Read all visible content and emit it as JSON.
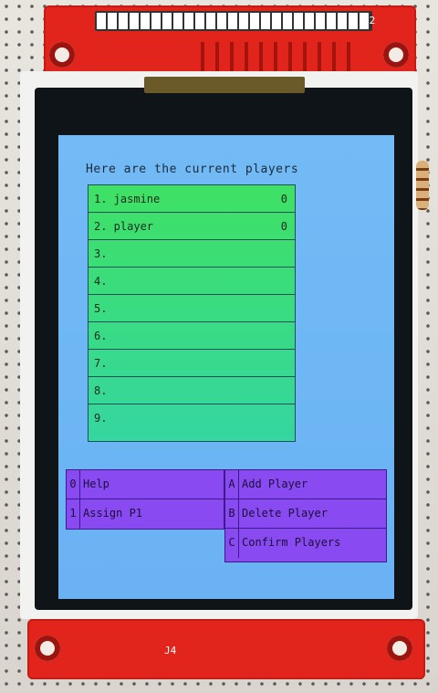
{
  "device": {
    "top_silk": "J2",
    "bottom_silk": "J4"
  },
  "screen": {
    "title": "Here are the current players",
    "players": [
      {
        "label": "1. jasmine",
        "score": "0"
      },
      {
        "label": "2. player",
        "score": "0"
      },
      {
        "label": "3.",
        "score": ""
      },
      {
        "label": "4.",
        "score": ""
      },
      {
        "label": "5.",
        "score": ""
      },
      {
        "label": "6.",
        "score": ""
      },
      {
        "label": "7.",
        "score": ""
      },
      {
        "label": "8.",
        "score": ""
      },
      {
        "label": "9.",
        "score": ""
      }
    ],
    "menu_left": [
      {
        "key": "0",
        "label": "Help"
      },
      {
        "key": "1",
        "label": "Assign P1"
      }
    ],
    "menu_right": [
      {
        "key": "A",
        "label": "Add Player"
      },
      {
        "key": "B",
        "label": "Delete Player"
      },
      {
        "key": "C",
        "label": "Confirm Players"
      }
    ]
  },
  "colors": {
    "lcd_background": "#6fb6f4",
    "player_table": "#3ee164",
    "menu": "#8a4af2",
    "pcb": "#e1251c"
  }
}
